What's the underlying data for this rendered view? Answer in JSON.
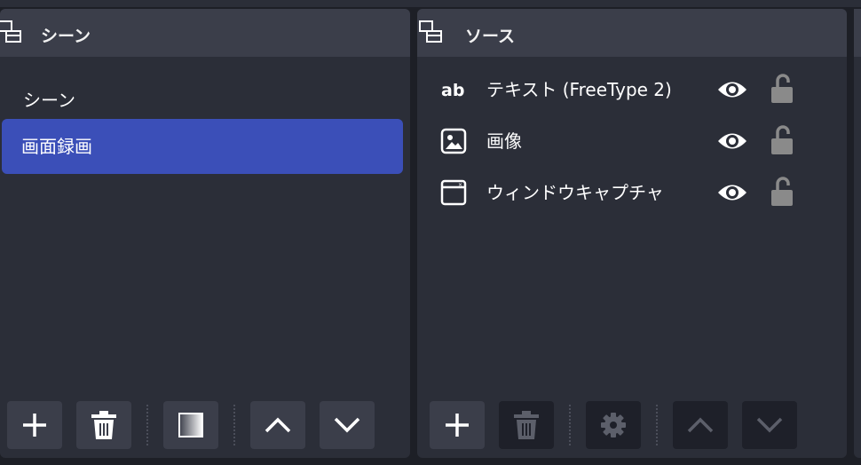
{
  "scenes_dock": {
    "title": "シーン",
    "items": [
      {
        "label": "シーン",
        "selected": false
      },
      {
        "label": "画面録画",
        "selected": true
      }
    ],
    "toolbar": [
      "add-icon",
      "trash-icon",
      "transition-filter-icon",
      "chevron-up-icon",
      "chevron-down-icon"
    ]
  },
  "sources_dock": {
    "title": "ソース",
    "items": [
      {
        "label": "テキスト (FreeType 2)",
        "type_icon": "text-source-icon",
        "visible": true,
        "locked": false
      },
      {
        "label": "画像",
        "type_icon": "image-source-icon",
        "visible": true,
        "locked": false
      },
      {
        "label": "ウィンドウキャプチャ",
        "type_icon": "window-capture-icon",
        "visible": true,
        "locked": false
      }
    ],
    "toolbar": [
      "add-icon",
      "trash-icon",
      "gear-icon",
      "chevron-up-icon",
      "chevron-down-icon"
    ]
  },
  "colors": {
    "background": "#1d1f26",
    "panel": "#2b2e38",
    "header": "#3b3e4a",
    "selection": "#3b4fb8",
    "lock": "#8a8a8a"
  }
}
